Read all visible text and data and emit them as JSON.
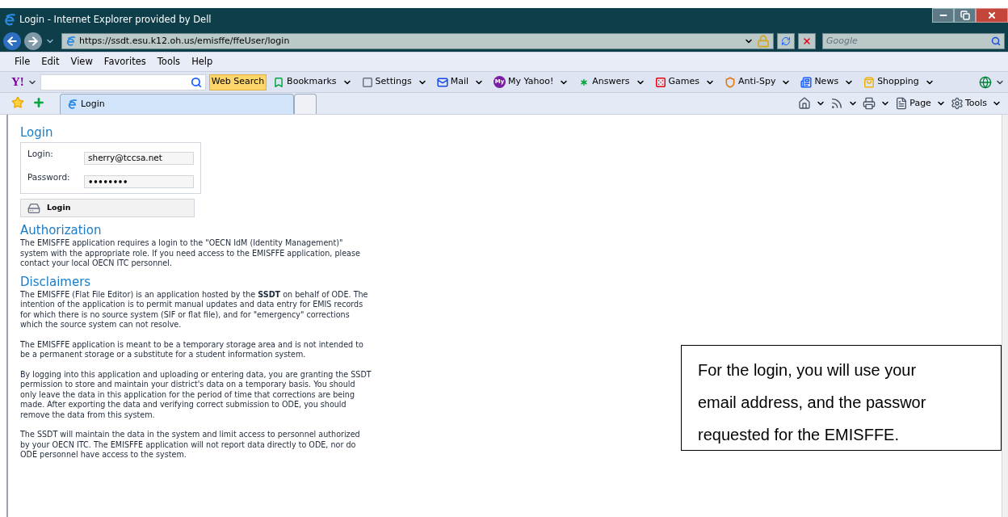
{
  "window": {
    "title": "Login - Internet Explorer provided by Dell"
  },
  "address_bar": {
    "url": "https://ssdt.esu.k12.oh.us/emisffe/ffeUser/login"
  },
  "search_box": {
    "placeholder": "Google"
  },
  "menu_bar": [
    {
      "label": "File"
    },
    {
      "label": "Edit"
    },
    {
      "label": "View"
    },
    {
      "label": "Favorites"
    },
    {
      "label": "Tools"
    },
    {
      "label": "Help"
    }
  ],
  "yahoo_toolbar": {
    "logo": "Y!",
    "search_button": "Web Search",
    "items": [
      {
        "kind": "bookmarks",
        "label": "Bookmarks"
      },
      {
        "kind": "settings",
        "label": "Settings"
      },
      {
        "kind": "mail",
        "label": "Mail"
      },
      {
        "kind": "myyahoo",
        "label": "My Yahoo!",
        "badge": "My"
      },
      {
        "kind": "answers",
        "label": "Answers"
      },
      {
        "kind": "games",
        "label": "Games"
      },
      {
        "kind": "antispy",
        "label": "Anti-Spy"
      },
      {
        "kind": "news",
        "label": "News"
      },
      {
        "kind": "shopping",
        "label": "Shopping"
      }
    ]
  },
  "tabs": [
    {
      "label": "Login",
      "selected": true
    }
  ],
  "command_bar": [
    {
      "kind": "home"
    },
    {
      "kind": "feeds"
    },
    {
      "kind": "print"
    },
    {
      "kind": "page",
      "label": "Page"
    },
    {
      "kind": "tools",
      "label": "Tools"
    }
  ],
  "page": {
    "login": {
      "heading": "Login",
      "fields": [
        {
          "label": "Login:",
          "value": "sherry@tccsa.net",
          "kind": "text"
        },
        {
          "label": "Password:",
          "value": "••••••••",
          "kind": "password"
        }
      ],
      "button": "Login"
    },
    "sections": [
      {
        "heading": "Authorization",
        "paragraphs": [
          "The EMISFFE application requires a login to the \"OECN IdM (Identity Management)\" system with the appropriate role. If you need access to the EMISFFE application, please contact your local OECN ITC personnel."
        ]
      },
      {
        "heading": "Disclaimers",
        "paragraphs": [
          "The EMISFFE (Flat File Editor) is an application hosted by the **SSDT** on behalf of ODE. The intention of the application is to permit manual updates and data entry for EMIS records for which there is no source system (SIF or flat file), and for \"emergency\" corrections which the source system can not resolve.",
          "The EMISFFE application is meant to be a temporary storage area and is not intended to be a permanent storage or a substitute for a student information system.",
          "By logging into this application and uploading or entering data, you are granting the SSDT permission to store and maintain your district's data on a temporary basis. You should only leave the data in this application for the period of time that corrections are being made. After exporting the data and verifying correct submission to ODE, you should remove the data from this system.",
          "The SSDT will maintain the data in the system and limit access to personnel authorized by your OECN ITC. The EMISFFE application will not report data directly to ODE, nor do ODE personnel have access to the system."
        ]
      }
    ]
  },
  "callout": {
    "lines": [
      "For the login, you will use your",
      "email address, and the passwor",
      "requested for the EMISFFE."
    ]
  }
}
